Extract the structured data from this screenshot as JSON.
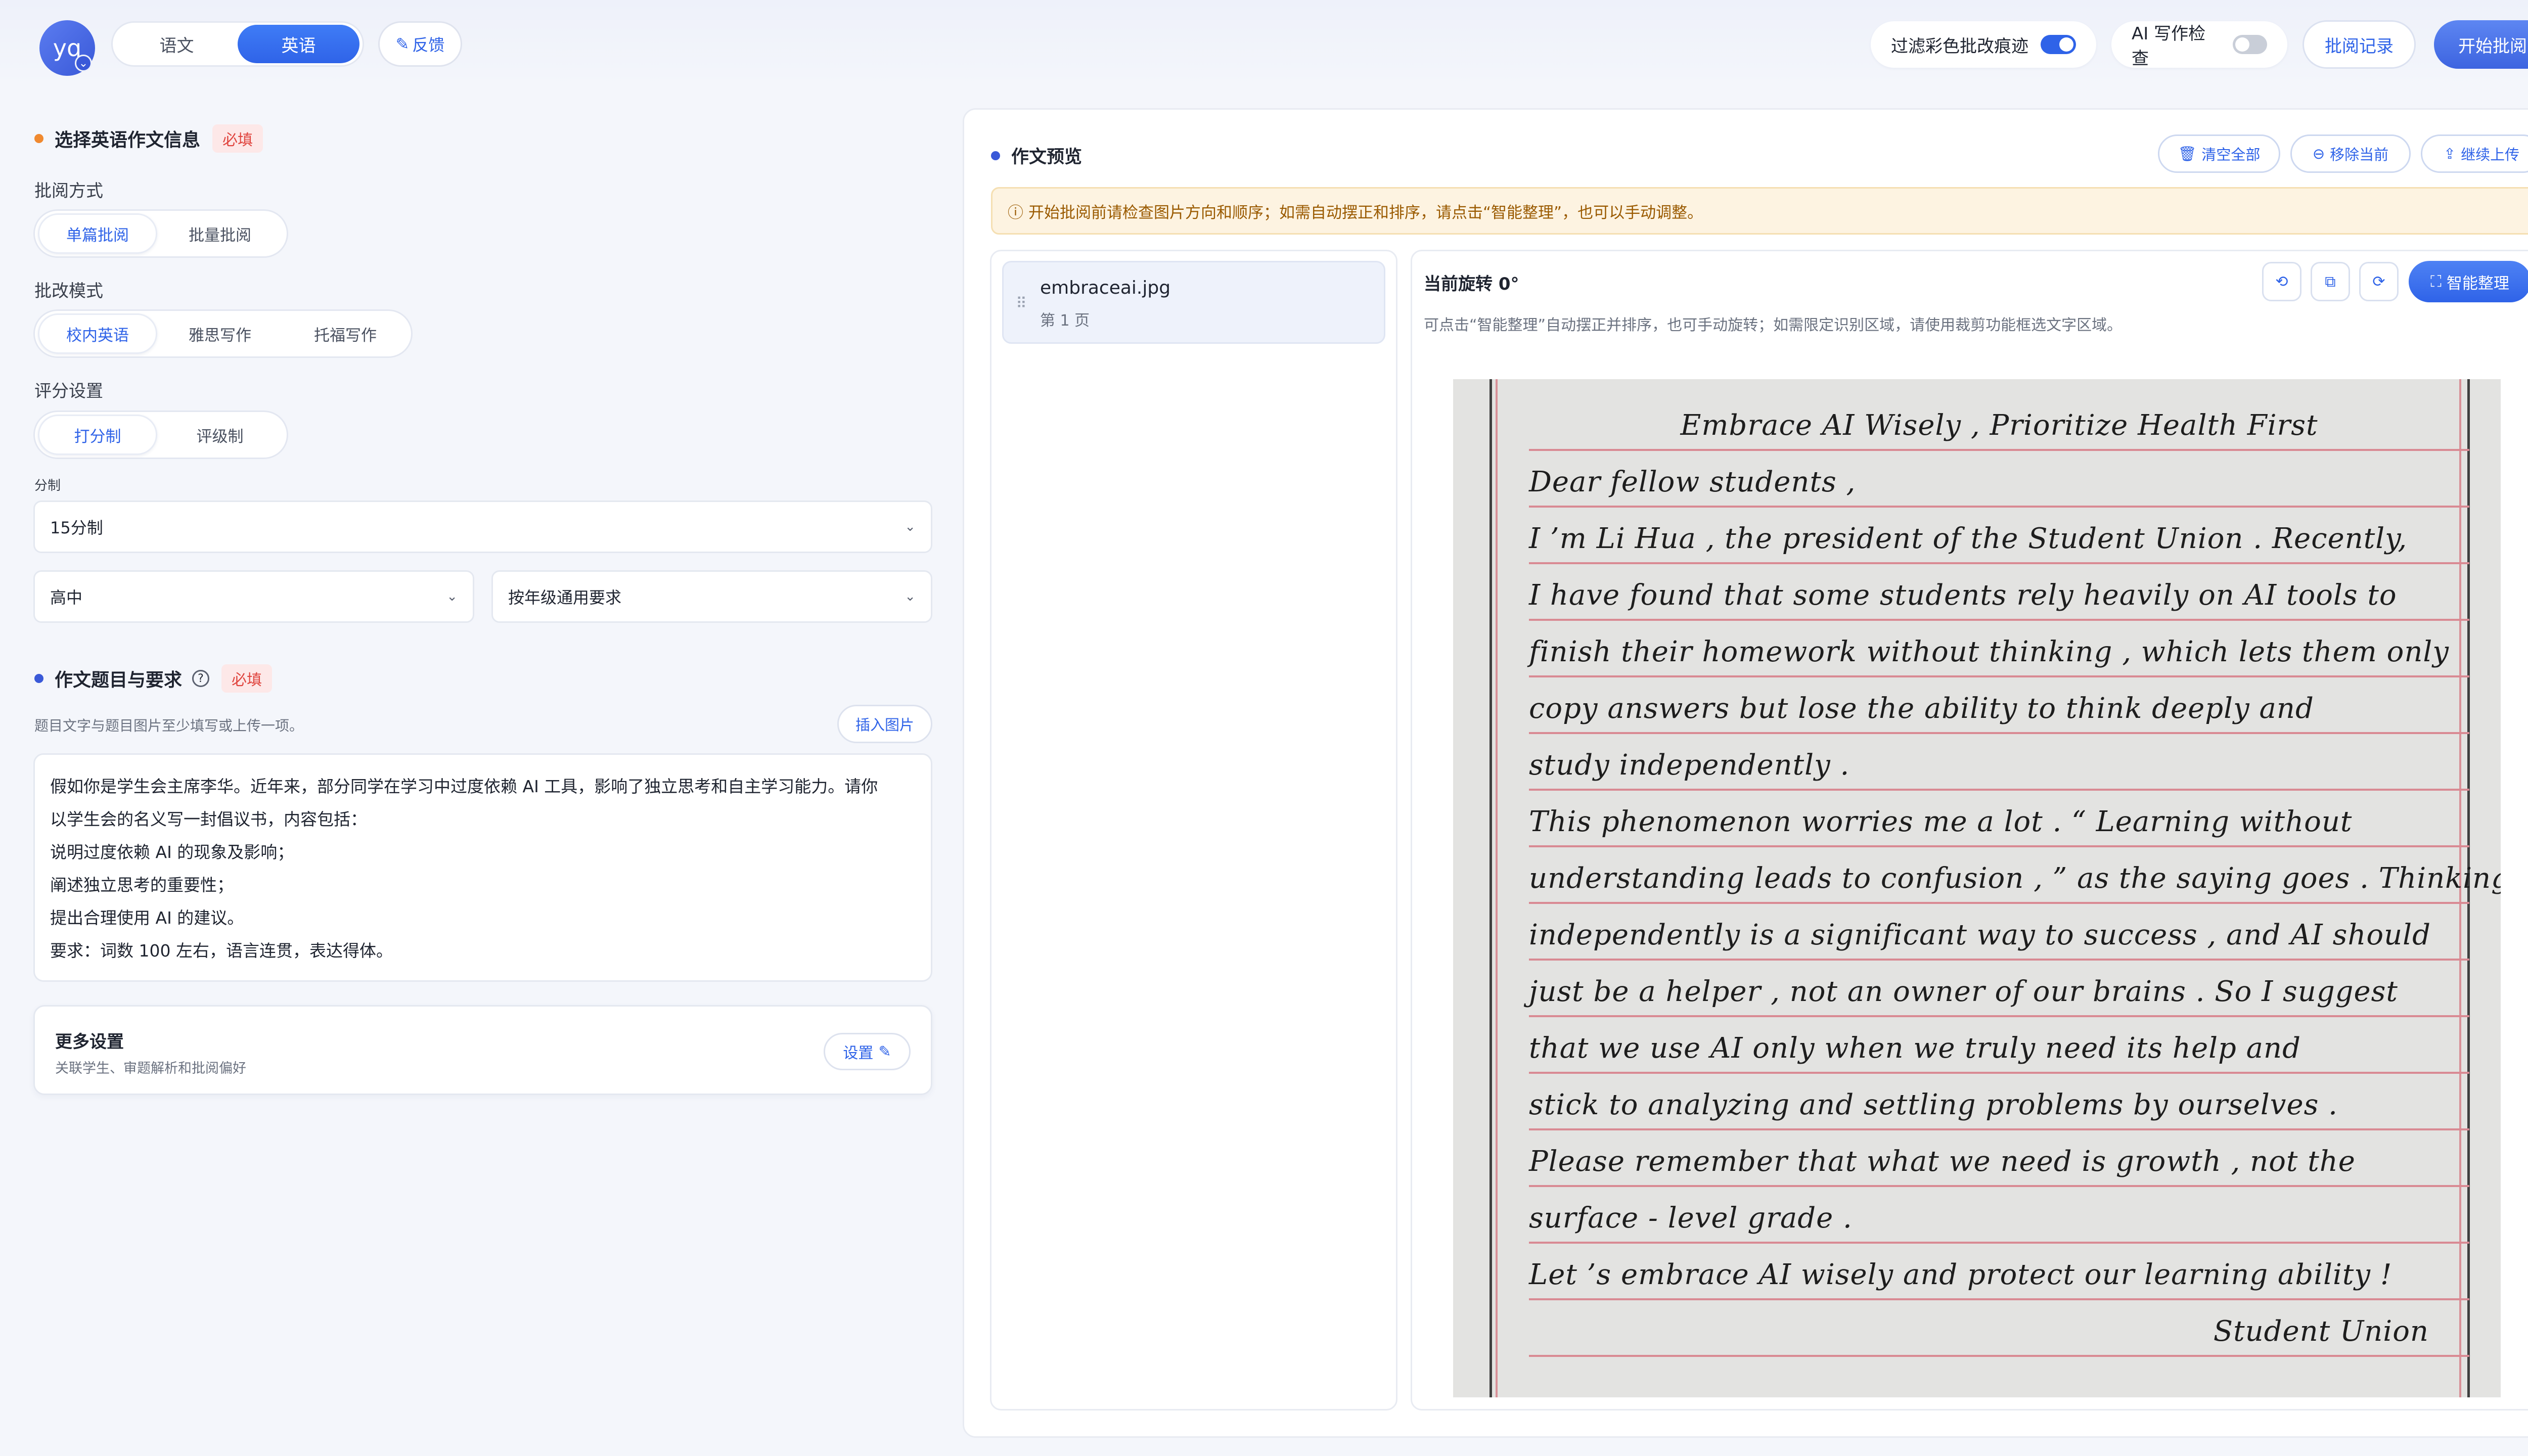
{
  "header": {
    "avatar_text": "yq",
    "subjects": [
      "语文",
      "英语"
    ],
    "feedback": "反馈",
    "filter_label": "过滤彩色批改痕迹",
    "ai_check_label": "AI 写作检查",
    "record_button": "批阅记录",
    "start_button": "开始批阅"
  },
  "form": {
    "section_title": "选择英语作文信息",
    "required": "必填",
    "method_label": "批阅方式",
    "method_options": [
      "单篇批阅",
      "批量批阅"
    ],
    "mode_label": "批改模式",
    "mode_options": [
      "校内英语",
      "雅思写作",
      "托福写作"
    ],
    "score_label": "评分设置",
    "score_options": [
      "打分制",
      "评级制"
    ],
    "scale_label": "分制",
    "scale_value": "15分制",
    "grade_value": "高中",
    "requirement_value": "按年级通用要求",
    "topic_title": "作文题目与要求",
    "topic_hint": "题目文字与题目图片至少填写或上传一项。",
    "insert_image": "插入图片",
    "topic_lines": [
      "假如你是学生会主席李华。近年来，部分同学在学习中过度依赖 AI 工具，影响了独立思考和自主学习能力。请你",
      "以学生会的名义写一封倡议书，内容包括：",
      "说明过度依赖 AI 的现象及影响；",
      "阐述独立思考的重要性；",
      "提出合理使用 AI 的建议。",
      "要求：词数 100 左右，语言连贯，表达得体。"
    ],
    "more_title": "更多设置",
    "more_sub": "关联学生、审题解析和批阅偏好",
    "more_button": "设置"
  },
  "preview": {
    "title": "作文预览",
    "clear_all": "清空全部",
    "remove_current": "移除当前",
    "continue_upload": "继续上传",
    "notice": "开始批阅前请检查图片方向和顺序；如需自动摆正和排序，请点击“智能整理”，也可以手动调整。",
    "file_name": "embraceai.jpg",
    "file_page": "第 1 页",
    "rotation": "当前旋转 0°",
    "rotation_hint": "可点击“智能整理”自动摆正并排序，也可手动旋转；如需限定识别区域，请使用裁剪功能框选文字区域。",
    "smart_button": "智能整理"
  },
  "essay": {
    "lines": [
      "Embrace AI Wisely , Prioritize Health First",
      "Dear  fellow  students ,",
      "      I ’m   Li  Hua , the  president  of   the   Student   Union . Recently,",
      "I  have  found  that  some  students  rely  heavily  on  AI  tools  to",
      "finish  their  homework  without  thinking , which  lets  them  only",
      "copy  answers  but  lose  the  ability  to  think  deeply  and",
      "study  independently .",
      "      This  phenomenon  worries  me  a  lot . “ Learning  without",
      "understanding  leads  to  confusion , ” as  the  saying  goes . Thinking",
      "independently  is  a  significant  way  to  success , and  AI  should",
      "just  be  a  helper , not  an  owner  of  our  brains . So  I  suggest",
      "that  we  use  AI  only  when  we  truly  need  its  help  and",
      "stick  to  analyzing  and  settling  problems  by  ourselves .",
      "Please  remember  that  what  we  need  is  growth , not  the",
      "surface - level  grade .",
      "      Let ’s  embrace  AI  wisely  and  protect  our  learning  ability !",
      "Student  Union"
    ]
  },
  "colors": {
    "accent": "#2f63e8",
    "required_bg": "#fde8e8",
    "required_fg": "#e0453f",
    "notice_bg": "#fdf3e1",
    "section_dot_orange": "#f0892f",
    "section_dot_blue": "#3a59d8"
  }
}
